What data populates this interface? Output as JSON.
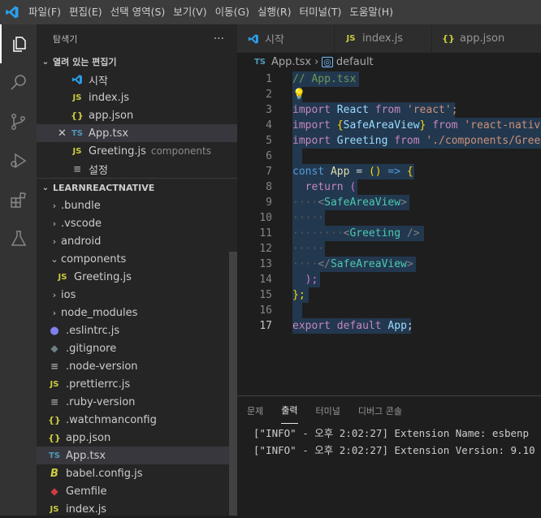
{
  "menu": [
    "파일(F)",
    "편집(E)",
    "선택 영역(S)",
    "보기(V)",
    "이동(G)",
    "실행(R)",
    "터미널(T)",
    "도움말(H)"
  ],
  "sidebar": {
    "title": "탐색기",
    "more": "···",
    "open_editors": {
      "title": "열려 있는 편집기",
      "items": [
        {
          "name": "시작",
          "desc": ""
        },
        {
          "name": "index.js",
          "desc": ""
        },
        {
          "name": "app.json",
          "desc": ""
        },
        {
          "name": "App.tsx",
          "desc": ""
        },
        {
          "name": "Greeting.js",
          "desc": "components"
        },
        {
          "name": "설정",
          "desc": ""
        }
      ]
    },
    "project": {
      "title": "LEARNREACTNATIVE",
      "items": [
        ".bundle",
        ".vscode",
        "android",
        "components",
        "Greeting.js",
        "ios",
        "node_modules",
        ".eslintrc.js",
        ".gitignore",
        ".node-version",
        ".prettierrc.js",
        ".ruby-version",
        ".watchmanconfig",
        "app.json",
        "App.tsx",
        "babel.config.js",
        "Gemfile",
        "index.js"
      ]
    }
  },
  "tabs": [
    "시작",
    "index.js",
    "app.json"
  ],
  "breadcrumbs": {
    "file": "App.tsx",
    "sep": "›",
    "symbol": "default"
  },
  "code": {
    "line_numbers": [
      "1",
      "2",
      "3",
      "4",
      "5",
      "6",
      "7",
      "8",
      "9",
      "10",
      "11",
      "12",
      "13",
      "14",
      "15",
      "16",
      "17"
    ],
    "l1": "// App.tsx",
    "l3": {
      "kw": "import",
      "id": "React",
      "from": "from",
      "str": "'react';"
    },
    "l4": {
      "kw": "import",
      "ob": "{",
      "id": "SafeAreaView",
      "cb": "}",
      "from": "from",
      "str": "'react-native'"
    },
    "l5": {
      "kw": "import",
      "id": "Greeting",
      "from": "from",
      "str": "'./components/Greeting'"
    },
    "l7": {
      "kw": "const",
      "id": "App",
      "eq": "=",
      "paren": "()",
      "arrow": "=>",
      "brace": "{"
    },
    "l8": {
      "kw": "return",
      "paren": "("
    },
    "l9": {
      "open": "<",
      "tag": "SafeAreaView",
      "close": ">"
    },
    "l11": {
      "open": "<",
      "tag": "Greeting",
      "close": "/>"
    },
    "l13": {
      "open": "</",
      "tag": "SafeAreaView",
      "close": ">"
    },
    "l14": ");",
    "l16": "};",
    "l17": {
      "kw1": "export",
      "kw2": "default",
      "id": "App",
      "semi": ";"
    }
  },
  "panel": {
    "tabs": [
      "문제",
      "출력",
      "터미널",
      "디버그 콘솔"
    ],
    "lines": [
      "[\"INFO\" - 오후 2:02:27] Extension Name: esbenp",
      "[\"INFO\" - 오후 2:02:27] Extension Version: 9.10"
    ]
  },
  "colors": {
    "accent": "#007acc",
    "titlebar": "#3c3c3c",
    "sidebar": "#252526",
    "editor": "#1e1e1e"
  }
}
